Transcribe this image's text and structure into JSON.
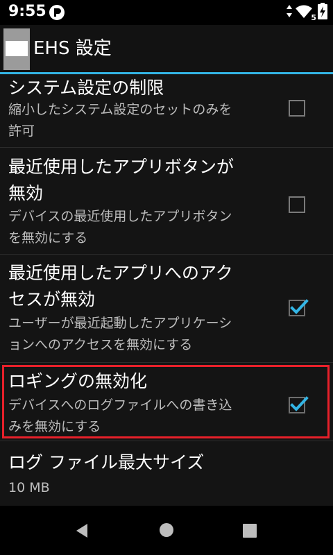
{
  "status": {
    "time": "9:55",
    "network_badge": "5"
  },
  "header": {
    "title": "EHS 設定"
  },
  "settings": [
    {
      "title": "システム設定の制限",
      "summary_lines": [
        "縮小したシステム設定のセットのみを",
        "許可"
      ],
      "checked": false
    },
    {
      "title_lines": [
        "最近使用したアプリボタンが",
        "無効"
      ],
      "summary_lines": [
        "デバイスの最近使用したアプリボタン",
        "を無効にする"
      ],
      "checked": false
    },
    {
      "title_lines": [
        "最近使用したアプリへのアク",
        "セスが無効"
      ],
      "summary_lines": [
        "ユーザーが最近起動したアプリケーシ",
        "ョンへのアクセスを無効にする"
      ],
      "checked": true
    },
    {
      "title": "ロギングの無効化",
      "summary_lines": [
        "デバイスへのログファイルへの書き込",
        "みを無効にする"
      ],
      "checked": true
    },
    {
      "title": "ログ ファイル最大サイズ",
      "summary": "10 MB"
    }
  ],
  "colors": {
    "accent": "#33b5e5",
    "highlight": "#e8202a",
    "checkmark": "#33b5e5"
  },
  "icons": {
    "back": "back-icon",
    "home": "home-icon",
    "recents": "recents-icon"
  }
}
